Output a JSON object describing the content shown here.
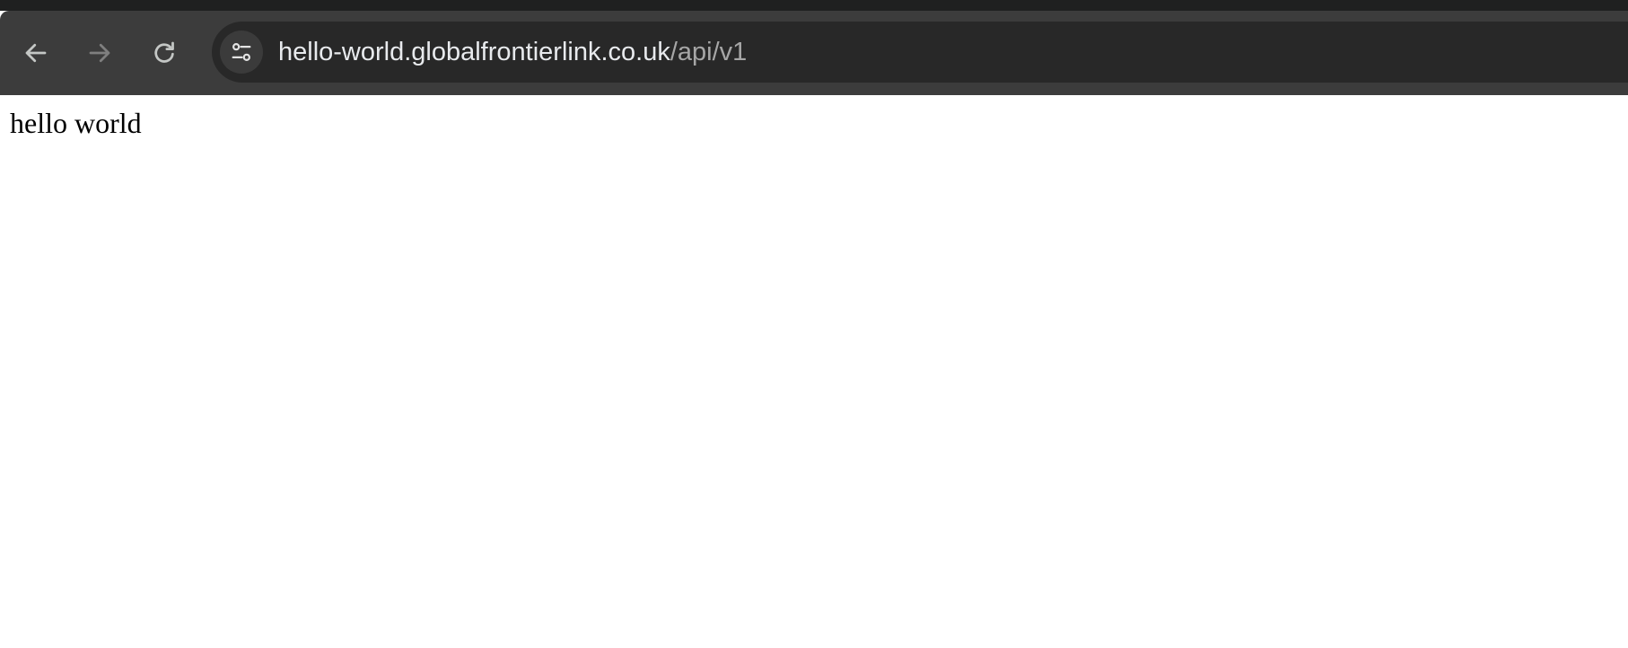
{
  "browser": {
    "address_bar": {
      "host": "hello-world.globalfrontierlink.co.uk",
      "path": "/api/v1"
    },
    "icons": {
      "back": "arrow-left-icon",
      "forward": "arrow-right-icon",
      "reload": "reload-icon",
      "site_info": "tune-icon"
    },
    "colors": {
      "toolbar_bg": "#3c3c3c",
      "omnibox_bg": "#282828",
      "icon_active": "#c4c7c5",
      "icon_disabled": "#7f7f7f"
    }
  },
  "page": {
    "text": "hello world"
  }
}
